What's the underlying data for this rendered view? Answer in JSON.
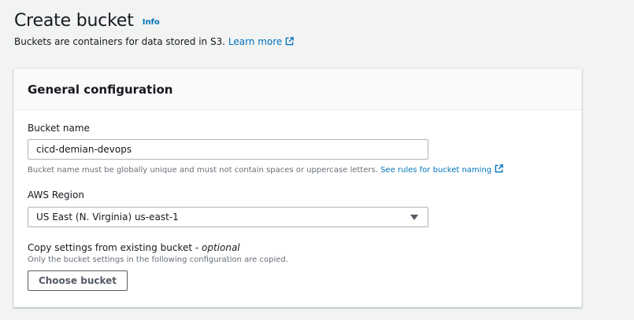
{
  "header": {
    "title": "Create bucket",
    "info_label": "Info",
    "description": "Buckets are containers for data stored in S3.",
    "learn_more": "Learn more"
  },
  "general_config": {
    "title": "General configuration",
    "bucket_name": {
      "label": "Bucket name",
      "value": "cicd-demian-devops",
      "hint": "Bucket name must be globally unique and must not contain spaces or uppercase letters.",
      "rules_link": "See rules for bucket naming"
    },
    "region": {
      "label": "AWS Region",
      "selected": "US East (N. Virginia) us-east-1"
    },
    "copy_settings": {
      "label": "Copy settings from existing bucket -",
      "optional": "optional",
      "hint": "Only the bucket settings in the following configuration are copied.",
      "button": "Choose bucket"
    }
  },
  "colors": {
    "link": "#0073bb",
    "background": "#f2f3f3",
    "panel_header": "#fafafa",
    "text": "#16191f",
    "muted": "#687078"
  },
  "icons": {
    "external_link": "external-link-icon",
    "dropdown_caret": "caret-down-icon"
  }
}
